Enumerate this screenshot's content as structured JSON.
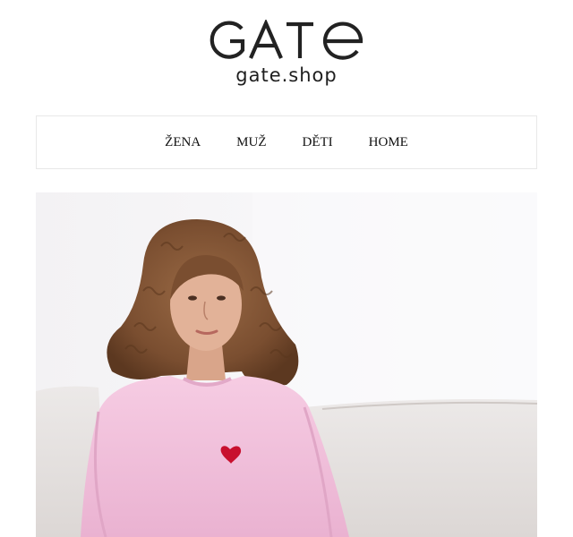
{
  "brand": {
    "logo_text": "GATE",
    "domain": "gate.shop"
  },
  "nav": {
    "items": [
      {
        "label": "ŽENA"
      },
      {
        "label": "MUŽ"
      },
      {
        "label": "DĚTI"
      },
      {
        "label": "HOME"
      }
    ]
  },
  "colors": {
    "text": "#111111",
    "border": "#e8e8e8",
    "hero_background": "#f4f2f4",
    "sweater_pink": "#f2c0dc",
    "heart_red": "#c8102e"
  },
  "hero": {
    "icon": "model-photo"
  }
}
